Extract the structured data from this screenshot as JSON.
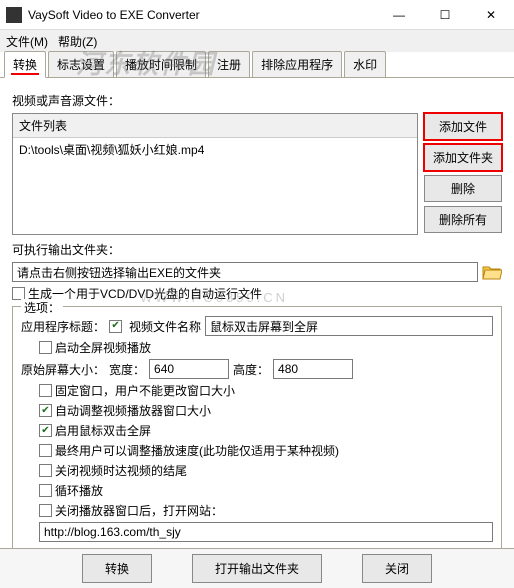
{
  "window": {
    "title": "VaySoft Video to EXE Converter",
    "min": "—",
    "max": "☐",
    "close": "✕"
  },
  "menu": {
    "file": "文件(M)",
    "help": "帮助(Z)"
  },
  "tabs": [
    "转换",
    "标志设置",
    "播放时间限制",
    "注册",
    "排除应用程序",
    "水印"
  ],
  "label_source": "视频或声音源文件：",
  "filelist": {
    "header": "文件列表",
    "items": [
      "D:\\tools\\桌面\\视频\\狐妖小红娘.mp4"
    ]
  },
  "buttons": {
    "add_file": "添加文件",
    "add_folder": "添加文件夹",
    "delete": "删除",
    "delete_all": "删除所有"
  },
  "out_label": "可执行输出文件夹：",
  "out_path": "请点击右侧按钮选择输出EXE的文件夹",
  "vcd_label": "生成一个用于VCD/DVD光盘的自动运行文件",
  "options_title": "选项：",
  "app_title_label": "应用程序标题：",
  "video_filename_label": "视频文件名称",
  "tip_text": "鼠标双击屏幕到全屏",
  "fullscreen_label": "启动全屏视频播放",
  "orig_size_label": "原始屏幕大小：",
  "width_label": "宽度：",
  "width_val": "640",
  "height_label": "高度：",
  "height_val": "480",
  "fixed_win_label": "固定窗口，用户不能更改窗口大小",
  "auto_adjust_label": "自动调整视频播放器窗口大小",
  "dbl_full_label": "启用鼠标双击全屏",
  "speed_label": "最终用户可以调整播放速度(此功能仅适用于某种视频)",
  "close_end_label": "关闭视频时达视频的结尾",
  "loop_label": "循环播放",
  "open_url_label": "关闭播放器窗口后，打开网站：",
  "url_val": "http://blog.163.com/th_sjy",
  "footer": {
    "convert": "转换",
    "open_out": "打开输出文件夹",
    "close": "关闭"
  },
  "watermark": "河东软件园",
  "watermark_sub": "WWW.PC0359.CN"
}
